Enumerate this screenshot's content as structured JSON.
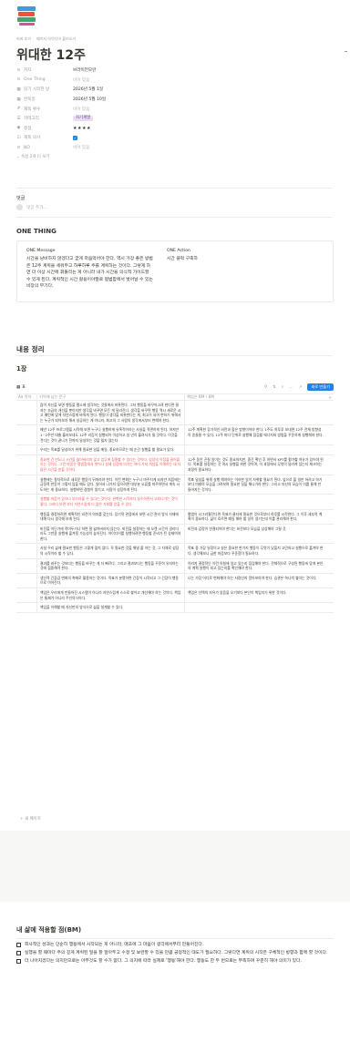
{
  "breadcrumb": [
    "커버 추가",
    "페이지 아이디어 불러오기"
  ],
  "page_title": "위대한 12주",
  "properties": [
    {
      "icon": "≡",
      "key": "저자",
      "value": "브라이언모란",
      "empty": false
    },
    {
      "icon": "≡",
      "key": "One Thing",
      "value": "비어 있음",
      "empty": true
    },
    {
      "icon": "▦",
      "key": "읽기 시작한 날",
      "value": "2026년 5월 1일",
      "empty": false
    },
    {
      "icon": "▦",
      "key": "완독일",
      "value": "2026년 5월 10일",
      "empty": false
    },
    {
      "icon": "#",
      "key": "재독 횟수",
      "value": "비어 있음",
      "empty": true
    },
    {
      "icon": "☰",
      "key": "카테고리",
      "value": "자기계발",
      "type": "tag"
    },
    {
      "icon": "◉",
      "key": "평점",
      "value": "★★★★",
      "type": "stars"
    },
    {
      "icon": "☑",
      "key": "재독 의사",
      "value": "✓",
      "type": "checkbox"
    },
    {
      "icon": "≡",
      "key": "NO",
      "value": "비어 있음",
      "empty": true
    }
  ],
  "more_props": "속성 2개 더 보기",
  "comments": {
    "label": "댓글",
    "placeholder": "댓글 추가..."
  },
  "one_thing": {
    "heading": "ONE THING",
    "message_title": "ONE Message",
    "message_text": "시간을 낭비하지 않겠다고 굳게 마음먹어야 한다. 역시 가장 좋은 방법은 12주 계획을 세워두고 하루하루 주를 계획하는 것이다. 그렇게 하면 더 이상 시간에 휘둘리는 게 아니라 내가 시간을 의식적 가이드할 수 있게 된다. 계획적인 시간 활용이야말로 평범함에서 벗어날 수 있는 비장의 무기다.",
    "action_title": "ONE Action",
    "action_text": "시간 블럭 구축하"
  },
  "content_heading": "내용 정리",
  "week_heading": "1장",
  "db": {
    "view_label": "표",
    "tools": [
      "필터",
      "정렬",
      "검색",
      "...",
      "↗"
    ],
    "new_label": "새로 만들기"
  },
  "table": {
    "col_day": "Aa 목차",
    "col_text": "기억에 남는 문구",
    "col_bm": "책임은 BM / BM",
    "rows": [
      {
        "text": "많이 자신을 보면 행동을 평소에 생각하는 것들에서 비롯된다. 그저 행동을 바꾸어고려 한다면 결과는 조금의 개선을 뿐이지만 생각을 바꾸면 모든 게 달라진다. 생각을 바꾸면 행동 역시 새로운 시고 패턴에 맞게 자연스럽게 바꿔게 된다. 행동이 생각을 비롯한다는 게, 최고가 되어 변하기 위해서는 누군가 되어보자 해서 성공하는 게 아니라, 최고의 그 사람의 생각에서부터 변해야 한다.",
        "bm": ""
      },
      {
        "text": "매년 12주 프로그램을 시작해 보면 누구나 실행하게 유혹적이라는 사실을 직면하게 된다. 하지만 1~2주만 대충 흘러보내도 12주 리듬이 실행되어 이상하고 일 년이 흘려서가 될 것이다. 이것을 견디는 것이 끝나기 전까지 달성하는 것을 잃지 않는다.",
        "bm": "12주 계획한 장기적인 비전과 합은 방향이어야 한다. 1주도 허투루 보내면 12주 전체 방향성이 흔들릴 수 있다. 12주 마다 단위로 실행해 점검할 에너지와 방법을 꾸준하게 실행해야 한다."
      },
      {
        "text": "우리는 목표를 달성하기 위해 필요한 일을 매일, 중요하므로는 매 순간 실행을 할 필요가 있다.",
        "bm": ""
      },
      {
        "text": "중요한 건 빈도나 시간을 잃어버리지 않고 업무에 집중할 수 있다는 것이다. 성장의 이점을 끌어올리는 것이다. 그런 마음은 평범함에서 벗어나 실제 성장에 미치는 여러 가지 개념을 이해하는 데 더 많은 시간을 쏟을 것이다.",
        "bm": "12주 동안 끈질 일이는 것도 중요하지만, 중간 확인 후 하면서 KPT를 평가할 여유가 있어야 된다. 목표를 설정하는 것 역시 실행을 위한 것이며, 이 과정에서 무엇이 달라져 있는지 체크하는 과정이 중요하다."
      },
      {
        "text": "실행에는 절차적으로 새로운 행동이 뒤따라야 한다. 이런 변화는 누구나 마주치게 되지만 처음에는 긍정적 반응이 그렇지 않을 때도 있다. 일어서 나가지 않으려면 대부분 오류를 마주하면서 계속 시도하는 게 중요하다. 실행하면 경험이 생기고, 사람이 성장하게 된다.",
        "bm": "목표 달성을 위해 실행 해야하는 이러한 일이 자취할 필요가 된다. 앞으로 올 일만 하려고 하기 보다 미래의 모습을 그려보며 필요한 일을 해나가야 한다. 그리고 자신의 모습이 이를 통해 만들어지는 것이다."
      },
      {
        "text": "실행할 마음이 있으나 부끄러울 수 있다는 것이다. 완벽한 시작보다 실수하면서 고쳐나가는 것이 좋다. 그러다 보면 보다 자연스럽게 더 많은 기회를 얻을 수 있다.",
        "bm": ""
      },
      {
        "text": "행동을 결정하려면 계획적인 비전이 의미를 갖는다. 장기적 관점에서 보면 시간 관리 방식 자체에 대해 다시 생각해 보게 된다.",
        "bm": "평범이 시그러웠던다면 목표가 클지에 필요한 것으로부터 하루를 시작한다. 그 이후 세부적 계획이 중요하다. 삶이 흐르면 매일 해야 할 일이 생기는데 이를 관리해야 한다."
      },
      {
        "text": "비전을 어딘가에 적어두거나 하면 잘 잃어버리지 않는다. 비전을 설정하는 데 오랜 시간이 걸리더라도 그만큼 실행에 옮겨질 가능성이 높아진다. 아이디어를 실행하려면 행동할 준비가 된 상태여야 한다.",
        "bm": "비전과 감정이 연결되어야 한다는 비전보다 모습을 상상해야 그릴 것."
      },
      {
        "text": "사실 우리 삶에 필요한 행동은 그렇게 많지 않다. 꼭 필요한 것을 해낼 줄 아는 것, 그 자체로 성장의 시작이라 할 수 있다.",
        "bm": "목표 중 가장 일정이고 실은 중요한 한가지 행동이 무엇이 있을지 고민하고 실행으로 옮겨야 한다. 생각해보니 급한 마음보다 꾸준함이 필요하다."
      },
      {
        "text": "결과를 바꾸는 것보다는 행동을 바꾸는 게 더 빠르다. 그리고 결과보다는 행동을 꾸준히 유지하는 것에 집중해야 한다.",
        "bm": "이러지 결정적인 이런 아침에 일고 있는지 점검해야 한다. 전체적으로 구성된 행동에 맞게 본인의 계획 실행이 되고 있는지를 확인해야 한다."
      },
      {
        "text": "생산적 긴장감 변화의 촉매로 활용하는 것이다. 목표가 분명하면 긴장이 시작되고 그 긴장이 행동으로 이어진다.",
        "bm": "나는 가장 어디로 변화해야 하는 사람인지 알아보아야 한다. 습관은 하나씩 쌓이는 것이다."
      },
      {
        "text": "책임은 우리에게 만들어진 시스템이 아니라 자연스럽게 스스로 쌓이고 개선해야 하는 것이다. 책임은 통제가 아니라 주인의식이다.",
        "bm": "책임은 선택의 자유가 있음을 오기보다 본인이 책임지기 위한 것이다."
      },
      {
        "text": "책임을 이해할 때 자신만의 방식으로 삶을 설계할 수 있다.",
        "bm": ""
      }
    ]
  },
  "new_page_label": "+ 새 페이지",
  "bm_section": {
    "heading": "내 삶에 적용할 점(BM)",
    "items": [
      "회사적인 성과는 단순히 행동에서 시작되는 게 아니라, 매초에 그 마음이 생각에서부터 만들어진다.",
      "실행을 할 때마다 주의 깊게 계획된 일을 잘 알아두고 수정 및 보완할 수 있을 만큼 긍정적인 태도가 필요하다. 그렇다면 계획의 시작은 구체적인 방향과 함께 할 것이다.",
      "더 나아지겠다는 의지만으로는 아무것도 할 수가 없다. 그 의지에 따라 실제로 '행동'해야 한다. 행동도 한 두 번으로는 부족하며 꾸준히 해야 의미가 있다."
    ]
  }
}
